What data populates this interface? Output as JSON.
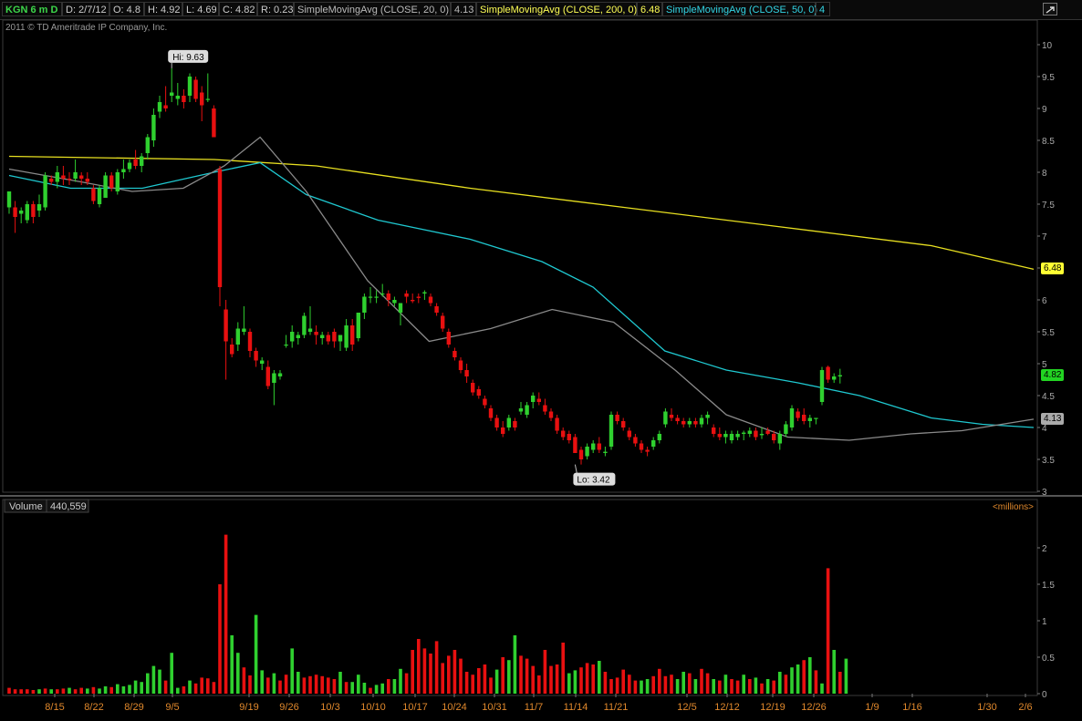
{
  "header": {
    "symbol": "KGN 6 m D",
    "date": "D: 2/7/12",
    "open": "O: 4.8",
    "high": "H: 4.92",
    "low": "L: 4.69",
    "close": "C: 4.82",
    "range": "R: 0.23",
    "sma20_label": "SimpleMovingAvg (CLOSE, 20, 0)",
    "sma20_value": "4.13",
    "sma200_label": "SimpleMovingAvg (CLOSE, 200, 0)",
    "sma200_value": "6.48",
    "sma50_label": "SimpleMovingAvg (CLOSE, 50, 0)",
    "sma50_value": "4"
  },
  "copyright": "2011 © TD Ameritrade IP Company, Inc.",
  "colors": {
    "up": "#2fd02f",
    "down": "#e81010",
    "sma20": "#8a8a8a",
    "sma200": "#e8e020",
    "sma50": "#1fc8d0",
    "sma20_text": "#bbbbbb",
    "sma200_text": "#ffff55",
    "sma50_text": "#33d6e6"
  },
  "chart_data": [
    {
      "type": "candlestick",
      "ylim": [
        3,
        10.2
      ],
      "yticks": [
        "3",
        "3.5",
        "4",
        "4.5",
        "5",
        "5.5",
        "6",
        "6.5",
        "7",
        "7.5",
        "8",
        "8.5",
        "9",
        "9.5",
        "10"
      ],
      "xticks": [
        "8/15",
        "8/22",
        "8/29",
        "9/5",
        "9/19",
        "9/26",
        "10/3",
        "10/10",
        "10/17",
        "10/24",
        "10/31",
        "11/7",
        "11/14",
        "11/21",
        "12/5",
        "12/12",
        "12/19",
        "12/26",
        "1/9",
        "1/16",
        "1/30",
        "2/6"
      ],
      "high_label": "Hi: 9.63",
      "low_label": "Lo: 3.42",
      "price_tags": {
        "sma200": "6.48",
        "last": "4.82",
        "sma20": "4.13"
      },
      "ohlc": [
        [
          7.45,
          7.7,
          7.35,
          7.7
        ],
        [
          7.45,
          7.55,
          7.05,
          7.3
        ],
        [
          7.35,
          7.45,
          7.2,
          7.4
        ],
        [
          7.25,
          7.55,
          7.2,
          7.5
        ],
        [
          7.5,
          7.55,
          7.2,
          7.3
        ],
        [
          7.4,
          7.65,
          7.3,
          7.5
        ],
        [
          7.45,
          8.0,
          7.4,
          7.95
        ],
        [
          7.9,
          7.95,
          7.8,
          7.85
        ],
        [
          7.85,
          8.1,
          7.75,
          8.0
        ],
        [
          7.95,
          8.1,
          7.8,
          7.9
        ],
        [
          7.9,
          8.0,
          7.8,
          7.88
        ],
        [
          7.9,
          8.2,
          7.85,
          8.0
        ],
        [
          7.95,
          8.0,
          7.8,
          7.9
        ],
        [
          7.9,
          8.0,
          7.8,
          7.85
        ],
        [
          7.75,
          7.8,
          7.5,
          7.55
        ],
        [
          7.5,
          7.8,
          7.45,
          7.75
        ],
        [
          7.6,
          8.0,
          7.6,
          7.95
        ],
        [
          7.95,
          8.0,
          7.7,
          7.75
        ],
        [
          7.7,
          8.05,
          7.65,
          8.0
        ],
        [
          8.0,
          8.2,
          7.9,
          8.05
        ],
        [
          8.05,
          8.2,
          8.0,
          8.15
        ],
        [
          8.2,
          8.35,
          8.05,
          8.1
        ],
        [
          8.1,
          8.3,
          8.0,
          8.25
        ],
        [
          8.3,
          8.6,
          8.2,
          8.55
        ],
        [
          8.5,
          9.0,
          8.4,
          8.9
        ],
        [
          8.95,
          9.2,
          8.85,
          9.1
        ],
        [
          9.05,
          9.35,
          8.95,
          9.0
        ],
        [
          9.2,
          9.63,
          9.1,
          9.25
        ],
        [
          9.15,
          9.4,
          9.05,
          9.2
        ],
        [
          9.2,
          9.3,
          9.0,
          9.1
        ],
        [
          9.2,
          9.55,
          9.1,
          9.5
        ],
        [
          9.45,
          9.5,
          9.1,
          9.15
        ],
        [
          9.25,
          9.35,
          8.8,
          9.05
        ],
        [
          9.15,
          9.55,
          9.1,
          9.15
        ],
        [
          9.0,
          9.05,
          8.55,
          8.55
        ],
        [
          8.05,
          8.1,
          5.9,
          6.2
        ],
        [
          5.85,
          6.0,
          4.75,
          5.35
        ],
        [
          5.3,
          5.4,
          5.1,
          5.15
        ],
        [
          5.3,
          5.65,
          5.2,
          5.55
        ],
        [
          5.5,
          5.9,
          5.45,
          5.55
        ],
        [
          5.5,
          5.55,
          5.1,
          5.2
        ],
        [
          5.2,
          5.25,
          4.95,
          5.05
        ],
        [
          5.0,
          5.1,
          4.9,
          5.05
        ],
        [
          4.95,
          5.05,
          4.6,
          4.65
        ],
        [
          4.7,
          4.9,
          4.35,
          4.85
        ],
        [
          4.8,
          4.9,
          4.75,
          4.85
        ],
        [
          5.3,
          5.45,
          5.25,
          5.3
        ],
        [
          5.35,
          5.6,
          5.25,
          5.5
        ],
        [
          5.4,
          5.5,
          5.3,
          5.45
        ],
        [
          5.45,
          5.8,
          5.4,
          5.75
        ],
        [
          5.5,
          5.9,
          5.45,
          5.55
        ],
        [
          5.5,
          5.6,
          5.3,
          5.45
        ],
        [
          5.4,
          5.5,
          5.3,
          5.45
        ],
        [
          5.45,
          5.5,
          5.3,
          5.35
        ],
        [
          5.5,
          5.55,
          5.25,
          5.35
        ],
        [
          5.35,
          5.45,
          5.2,
          5.45
        ],
        [
          5.25,
          5.7,
          5.2,
          5.6
        ],
        [
          5.6,
          5.7,
          5.2,
          5.3
        ],
        [
          5.4,
          5.8,
          5.35,
          5.8
        ],
        [
          5.8,
          6.1,
          5.7,
          6.05
        ],
        [
          6.05,
          6.2,
          5.95,
          6.05
        ],
        [
          6.05,
          6.15,
          5.95,
          6.05
        ],
        [
          6.1,
          6.25,
          6.05,
          6.1
        ],
        [
          6.1,
          6.15,
          5.9,
          6.0
        ],
        [
          5.95,
          6.05,
          5.9,
          6.0
        ],
        [
          5.8,
          5.95,
          5.6,
          5.95
        ],
        [
          6.1,
          6.15,
          5.95,
          6.05
        ],
        [
          6.0,
          6.1,
          5.95,
          5.98
        ],
        [
          6.05,
          6.1,
          5.95,
          6.03
        ],
        [
          6.1,
          6.15,
          6.0,
          6.12
        ],
        [
          6.05,
          6.1,
          5.9,
          5.95
        ],
        [
          5.9,
          5.95,
          5.75,
          5.8
        ],
        [
          5.75,
          5.8,
          5.5,
          5.55
        ],
        [
          5.5,
          5.55,
          5.25,
          5.3
        ],
        [
          5.2,
          5.25,
          5.05,
          5.1
        ],
        [
          5.05,
          5.1,
          4.85,
          4.9
        ],
        [
          4.9,
          5.0,
          4.7,
          4.8
        ],
        [
          4.7,
          4.75,
          4.5,
          4.55
        ],
        [
          4.6,
          4.65,
          4.45,
          4.5
        ],
        [
          4.45,
          4.5,
          4.3,
          4.35
        ],
        [
          4.3,
          4.35,
          4.1,
          4.15
        ],
        [
          4.15,
          4.2,
          3.95,
          4.0
        ],
        [
          4.0,
          4.1,
          3.85,
          3.9
        ],
        [
          4.0,
          4.2,
          3.95,
          4.15
        ],
        [
          4.1,
          4.15,
          3.95,
          4.0
        ],
        [
          4.25,
          4.4,
          4.2,
          4.3
        ],
        [
          4.2,
          4.4,
          4.15,
          4.35
        ],
        [
          4.4,
          4.55,
          4.3,
          4.5
        ],
        [
          4.45,
          4.55,
          4.35,
          4.4
        ],
        [
          4.35,
          4.45,
          4.2,
          4.25
        ],
        [
          4.25,
          4.3,
          4.1,
          4.15
        ],
        [
          4.15,
          4.2,
          3.9,
          3.95
        ],
        [
          3.95,
          4.0,
          3.8,
          3.85
        ],
        [
          3.9,
          3.95,
          3.75,
          3.8
        ],
        [
          3.85,
          3.9,
          3.6,
          3.6
        ],
        [
          3.65,
          3.7,
          3.42,
          3.5
        ],
        [
          3.55,
          3.75,
          3.5,
          3.7
        ],
        [
          3.65,
          3.8,
          3.6,
          3.75
        ],
        [
          3.75,
          3.85,
          3.6,
          3.65
        ],
        [
          3.6,
          3.7,
          3.55,
          3.62
        ],
        [
          3.7,
          4.25,
          3.65,
          4.2
        ],
        [
          4.2,
          4.25,
          4.05,
          4.1
        ],
        [
          4.1,
          4.15,
          3.95,
          4.0
        ],
        [
          3.95,
          4.0,
          3.8,
          3.85
        ],
        [
          3.85,
          3.9,
          3.7,
          3.75
        ],
        [
          3.75,
          3.8,
          3.6,
          3.65
        ],
        [
          3.65,
          3.7,
          3.55,
          3.62
        ],
        [
          3.7,
          3.85,
          3.65,
          3.8
        ],
        [
          3.8,
          3.95,
          3.75,
          3.9
        ],
        [
          4.05,
          4.3,
          4.0,
          4.25
        ],
        [
          4.2,
          4.3,
          4.1,
          4.15
        ],
        [
          4.15,
          4.2,
          4.05,
          4.1
        ],
        [
          4.1,
          4.15,
          4.0,
          4.05
        ],
        [
          4.05,
          4.15,
          4.0,
          4.1
        ],
        [
          4.1,
          4.15,
          4.0,
          4.05
        ],
        [
          4.05,
          4.2,
          4.0,
          4.15
        ],
        [
          4.15,
          4.25,
          4.05,
          4.2
        ],
        [
          4.0,
          4.05,
          3.85,
          3.9
        ],
        [
          3.9,
          4.0,
          3.8,
          3.85
        ],
        [
          3.85,
          3.95,
          3.75,
          3.9
        ],
        [
          3.8,
          3.95,
          3.75,
          3.9
        ],
        [
          3.85,
          3.95,
          3.8,
          3.9
        ],
        [
          3.9,
          3.95,
          3.8,
          3.92
        ],
        [
          3.9,
          4.0,
          3.85,
          3.95
        ],
        [
          3.95,
          4.0,
          3.8,
          3.85
        ],
        [
          3.88,
          4.0,
          3.82,
          3.9
        ],
        [
          3.95,
          4.0,
          3.88,
          3.9
        ],
        [
          3.9,
          3.95,
          3.75,
          3.8
        ],
        [
          3.75,
          3.95,
          3.65,
          3.9
        ],
        [
          3.9,
          4.1,
          3.85,
          4.05
        ],
        [
          4.0,
          4.35,
          3.95,
          4.3
        ],
        [
          4.25,
          4.3,
          4.1,
          4.15
        ],
        [
          4.2,
          4.3,
          4.05,
          4.1
        ],
        [
          4.1,
          4.2,
          4.0,
          4.15
        ],
        [
          4.15,
          4.15,
          4.05,
          4.15
        ],
        [
          4.4,
          4.95,
          4.35,
          4.9
        ],
        [
          4.95,
          4.97,
          4.7,
          4.75
        ],
        [
          4.75,
          4.85,
          4.7,
          4.8
        ],
        [
          4.8,
          4.92,
          4.69,
          4.82
        ]
      ],
      "sma20": [
        [
          0,
          8.05
        ],
        [
          0.07,
          7.85
        ],
        [
          0.12,
          7.7
        ],
        [
          0.17,
          7.75
        ],
        [
          0.21,
          8.1
        ],
        [
          0.245,
          8.55
        ],
        [
          0.29,
          7.7
        ],
        [
          0.35,
          6.3
        ],
        [
          0.41,
          5.35
        ],
        [
          0.47,
          5.55
        ],
        [
          0.53,
          5.85
        ],
        [
          0.59,
          5.65
        ],
        [
          0.65,
          4.9
        ],
        [
          0.7,
          4.2
        ],
        [
          0.76,
          3.85
        ],
        [
          0.82,
          3.8
        ],
        [
          0.88,
          3.9
        ],
        [
          0.93,
          3.95
        ],
        [
          1,
          4.13
        ]
      ],
      "sma50": [
        [
          0,
          7.95
        ],
        [
          0.06,
          7.75
        ],
        [
          0.13,
          7.75
        ],
        [
          0.2,
          8.0
        ],
        [
          0.245,
          8.15
        ],
        [
          0.29,
          7.65
        ],
        [
          0.36,
          7.25
        ],
        [
          0.45,
          6.95
        ],
        [
          0.52,
          6.6
        ],
        [
          0.57,
          6.2
        ],
        [
          0.64,
          5.2
        ],
        [
          0.7,
          4.9
        ],
        [
          0.77,
          4.7
        ],
        [
          0.83,
          4.5
        ],
        [
          0.9,
          4.15
        ],
        [
          0.95,
          4.05
        ],
        [
          1,
          4.0
        ]
      ],
      "sma200": [
        [
          0,
          8.25
        ],
        [
          0.2,
          8.2
        ],
        [
          0.3,
          8.1
        ],
        [
          0.45,
          7.75
        ],
        [
          0.6,
          7.45
        ],
        [
          0.75,
          7.15
        ],
        [
          0.9,
          6.85
        ],
        [
          1,
          6.48
        ]
      ]
    },
    {
      "type": "bar",
      "title": "Volume",
      "last_value": "440,559",
      "unit_label": "<millions>",
      "ylim": [
        0,
        2.45
      ],
      "yticks": [
        "0",
        "0.5",
        "1",
        "1.5",
        "2"
      ],
      "volume": [
        0.08,
        0.06,
        0.06,
        0.06,
        0.05,
        0.06,
        0.07,
        0.06,
        0.06,
        0.07,
        0.08,
        0.06,
        0.08,
        0.07,
        0.09,
        0.07,
        0.1,
        0.09,
        0.13,
        0.1,
        0.12,
        0.18,
        0.16,
        0.28,
        0.38,
        0.33,
        0.18,
        0.56,
        0.08,
        0.1,
        0.18,
        0.14,
        0.22,
        0.21,
        0.16,
        1.5,
        2.18,
        0.8,
        0.56,
        0.36,
        0.25,
        1.08,
        0.32,
        0.22,
        0.28,
        0.18,
        0.26,
        0.62,
        0.3,
        0.22,
        0.24,
        0.26,
        0.24,
        0.22,
        0.2,
        0.3,
        0.16,
        0.16,
        0.26,
        0.15,
        0.08,
        0.12,
        0.14,
        0.2,
        0.2,
        0.34,
        0.28,
        0.6,
        0.75,
        0.62,
        0.55,
        0.72,
        0.42,
        0.52,
        0.6,
        0.48,
        0.3,
        0.26,
        0.35,
        0.4,
        0.22,
        0.33,
        0.5,
        0.46,
        0.8,
        0.52,
        0.48,
        0.38,
        0.25,
        0.6,
        0.38,
        0.4,
        0.7,
        0.28,
        0.32,
        0.36,
        0.42,
        0.4,
        0.45,
        0.3,
        0.2,
        0.22,
        0.33,
        0.26,
        0.18,
        0.18,
        0.2,
        0.24,
        0.34,
        0.24,
        0.26,
        0.2,
        0.3,
        0.28,
        0.2,
        0.34,
        0.28,
        0.2,
        0.18,
        0.26,
        0.2,
        0.18,
        0.26,
        0.2,
        0.22,
        0.14,
        0.2,
        0.18,
        0.3,
        0.26,
        0.36,
        0.4,
        0.46,
        0.5,
        0.32,
        0.14,
        1.72,
        0.6,
        0.3,
        0.48
      ],
      "volume_up": [
        false,
        false,
        false,
        false,
        false,
        true,
        false,
        true,
        false,
        false,
        true,
        false,
        false,
        true,
        false,
        true,
        true,
        false,
        true,
        true,
        true,
        true,
        true,
        true,
        true,
        true,
        false,
        true,
        true,
        false,
        true,
        false,
        false,
        false,
        false,
        false,
        false,
        true,
        true,
        false,
        false,
        true,
        true,
        false,
        true,
        false,
        false,
        true,
        true,
        false,
        false,
        false,
        false,
        false,
        false,
        true,
        false,
        true,
        true,
        true,
        false,
        true,
        true,
        false,
        true,
        true,
        false,
        false,
        false,
        false,
        false,
        false,
        false,
        false,
        false,
        false,
        false,
        false,
        false,
        false,
        false,
        true,
        false,
        true,
        true,
        false,
        false,
        false,
        false,
        false,
        false,
        false,
        false,
        true,
        true,
        false,
        false,
        false,
        true,
        false,
        false,
        false,
        false,
        false,
        false,
        true,
        true,
        false,
        false,
        false,
        false,
        true,
        true,
        false,
        true,
        false,
        false,
        true,
        false,
        true,
        false,
        false,
        true,
        false,
        true,
        false,
        true,
        false,
        true,
        false,
        true,
        true,
        false,
        true,
        false,
        true,
        false,
        true,
        false,
        true
      ]
    }
  ]
}
